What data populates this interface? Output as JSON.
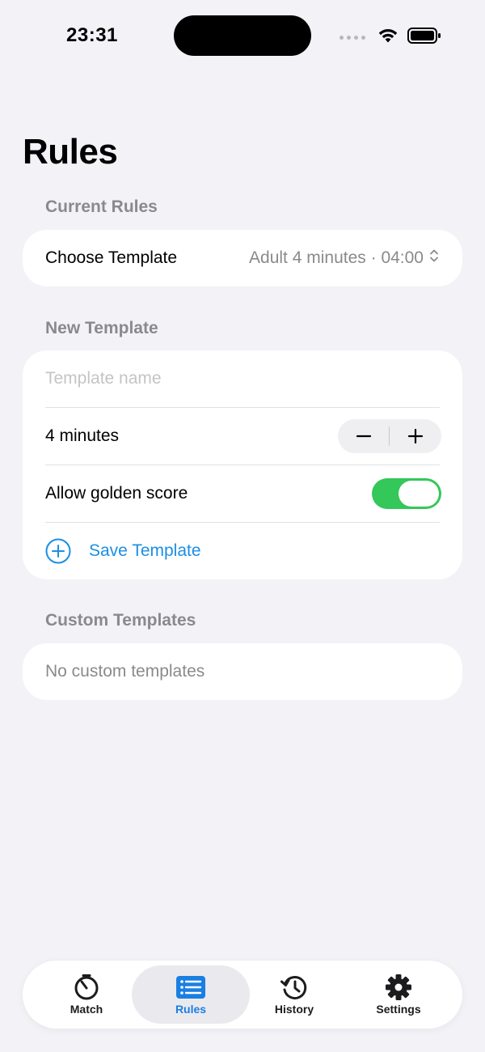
{
  "status_bar": {
    "time": "23:31",
    "wifi_icon": "wifi-icon",
    "battery_icon": "battery-icon"
  },
  "page": {
    "title": "Rules"
  },
  "current_rules": {
    "header": "Current Rules",
    "choose_template_label": "Choose Template",
    "selected_template": "Adult 4 minutes · 04:00"
  },
  "new_template": {
    "header": "New Template",
    "name_placeholder": "Template name",
    "name_value": "",
    "duration_label": "4 minutes",
    "golden_score_label": "Allow golden score",
    "golden_score_enabled": true,
    "save_label": "Save Template"
  },
  "custom_templates": {
    "header": "Custom Templates",
    "empty_text": "No custom templates"
  },
  "tabs": [
    {
      "label": "Match",
      "icon": "timer-icon",
      "active": false
    },
    {
      "label": "Rules",
      "icon": "list-icon",
      "active": true
    },
    {
      "label": "History",
      "icon": "history-icon",
      "active": false
    },
    {
      "label": "Settings",
      "icon": "gear-icon",
      "active": false
    }
  ],
  "colors": {
    "accent": "#1A8FE3",
    "toggle_on": "#34C759",
    "background": "#F2F2F7"
  }
}
